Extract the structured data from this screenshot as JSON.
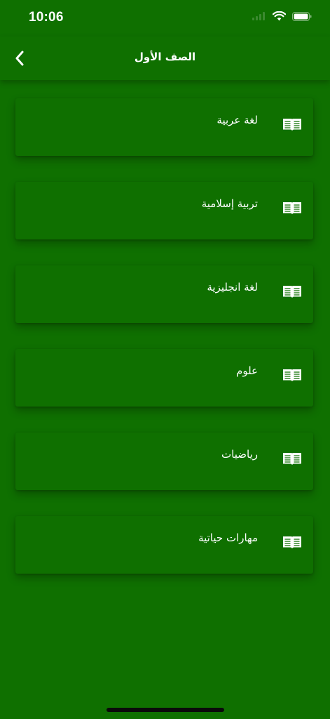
{
  "status": {
    "time": "10:06"
  },
  "nav": {
    "title": "الصف الأول",
    "back_icon": "chevron-left-icon"
  },
  "subjects": [
    {
      "label": "لغة عربية",
      "icon": "book-icon"
    },
    {
      "label": "تربية إسلامية",
      "icon": "book-icon"
    },
    {
      "label": "لغة انجليزية",
      "icon": "book-icon"
    },
    {
      "label": "علوم",
      "icon": "book-icon"
    },
    {
      "label": "رياضيات",
      "icon": "book-icon"
    },
    {
      "label": "مهارات حياتية",
      "icon": "book-icon"
    }
  ],
  "colors": {
    "background": "#0f7000",
    "text": "#ffffff"
  }
}
